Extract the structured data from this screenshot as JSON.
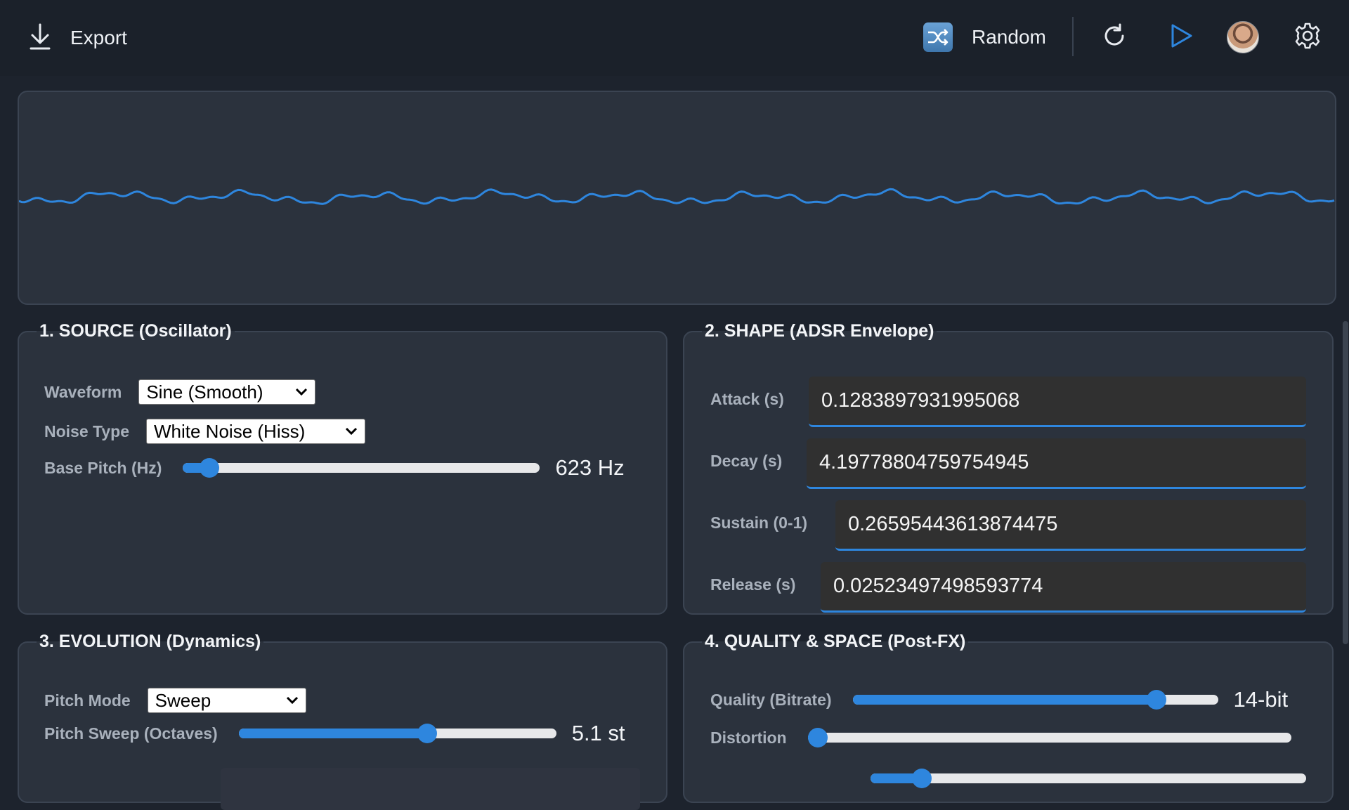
{
  "toolbar": {
    "export_label": "Export",
    "random_label": "Random",
    "icons": [
      "download-icon",
      "shuffle-icon",
      "refresh-icon",
      "play-icon",
      "avatar",
      "gear-icon"
    ]
  },
  "colors": {
    "accent": "#2e86de",
    "background": "#1d232d",
    "panel": "#2b323d"
  },
  "source": {
    "title": "1. SOURCE (Oscillator)",
    "waveform_label": "Waveform",
    "waveform_value": "Sine (Smooth)",
    "noise_label": "Noise Type",
    "noise_value": "White Noise (Hiss)",
    "pitch_label": "Base Pitch (Hz)",
    "pitch_display": "623 Hz",
    "pitch_fraction": 0.05
  },
  "shape": {
    "title": "2. SHAPE (ADSR Envelope)",
    "attack_label": "Attack (s)",
    "attack_value": "0.1283897931995068",
    "decay_label": "Decay (s)",
    "decay_value": "4.19778804759754945",
    "sustain_label": "Sustain (0-1)",
    "sustain_value": "0.26595443613874475",
    "release_label": "Release (s)",
    "release_value": "0.02523497498593774"
  },
  "evolution": {
    "title": "3. EVOLUTION (Dynamics)",
    "pitch_mode_label": "Pitch Mode",
    "pitch_mode_value": "Sweep",
    "sweep_label": "Pitch Sweep (Octaves)",
    "sweep_display": "5.1 st",
    "sweep_fraction": 0.6
  },
  "quality": {
    "title": "4. QUALITY & SPACE (Post-FX)",
    "bitrate_label": "Quality (Bitrate)",
    "bitrate_display": "14-bit",
    "bitrate_fraction": 0.85,
    "distortion_label": "Distortion",
    "distortion_fraction": 0.0,
    "filter_fraction": 0.1
  }
}
